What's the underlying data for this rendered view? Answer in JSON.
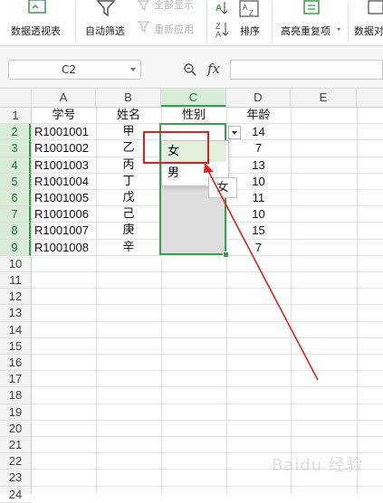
{
  "ribbon": {
    "pivot_label": "数据透视表",
    "autofilter_label": "自动筛选",
    "show_all_label": "全部显示",
    "reapply_label": "重新应用",
    "sort_label": "排序",
    "highlight_dup_label": "高亮重复项",
    "data_compare_label": "数据对"
  },
  "formula_bar": {
    "name_box": "C2",
    "fx_label": "fx",
    "formula_value": ""
  },
  "columns": [
    "A",
    "B",
    "C",
    "D",
    "E"
  ],
  "rows": [
    "1",
    "2",
    "3",
    "4",
    "5",
    "6",
    "7",
    "8",
    "9",
    "10",
    "11",
    "12",
    "13",
    "14",
    "15",
    "16",
    "17",
    "18",
    "19",
    "20",
    "21",
    "22",
    "23",
    "24"
  ],
  "sheet": {
    "header": {
      "a": "学号",
      "b": "姓名",
      "c": "性别",
      "d": "年龄"
    },
    "records": [
      {
        "a": "R1001001",
        "b": "甲",
        "d": "14"
      },
      {
        "a": "R1001002",
        "b": "乙",
        "d": "7"
      },
      {
        "a": "R1001003",
        "b": "丙",
        "d": "13"
      },
      {
        "a": "R1001004",
        "b": "丁",
        "d": "10"
      },
      {
        "a": "R1001005",
        "b": "戊",
        "d": "11"
      },
      {
        "a": "R1001006",
        "b": "己",
        "d": "10"
      },
      {
        "a": "R1001007",
        "b": "庚",
        "d": "15"
      },
      {
        "a": "R1001008",
        "b": "辛",
        "d": "7"
      }
    ]
  },
  "dropdown": {
    "options": [
      "女",
      "男"
    ],
    "highlighted": "女",
    "tooltip": "女"
  },
  "annotation_color": "#e02020",
  "selection_color": "#3aa050",
  "watermark": "Baidu 经验"
}
